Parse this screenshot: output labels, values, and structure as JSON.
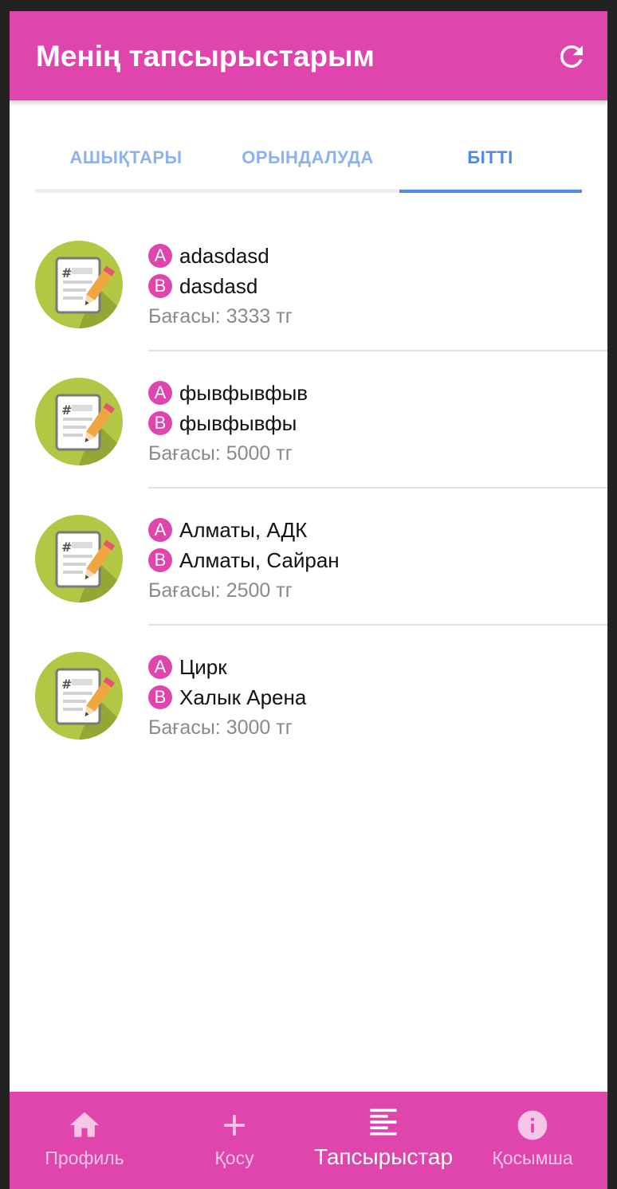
{
  "app_bar": {
    "title": "Менің тапсырыстарым",
    "refresh_icon": "refresh-icon"
  },
  "tabs": [
    {
      "label": "АШЫҚТАРЫ",
      "active": false
    },
    {
      "label": "ОРЫНДАЛУДА",
      "active": false
    },
    {
      "label": "БІТТІ",
      "active": true
    }
  ],
  "orders": [
    {
      "from_badge": "A",
      "from": "adasdasd",
      "to_badge": "B",
      "to": "dasdasd",
      "price": "Бағасы: 3333 тг",
      "icon": "notepad-pencil-icon"
    },
    {
      "from_badge": "A",
      "from": "фывфывфыв",
      "to_badge": "B",
      "to": "фывфывфы",
      "price": "Бағасы: 5000 тг",
      "icon": "notepad-pencil-icon"
    },
    {
      "from_badge": "A",
      "from": "Алматы, АДК",
      "to_badge": "B",
      "to": "Алматы, Сайран",
      "price": "Бағасы: 2500 тг",
      "icon": "notepad-pencil-icon"
    },
    {
      "from_badge": "A",
      "from": "Цирк",
      "to_badge": "B",
      "to": "Халык Арена",
      "price": "Бағасы: 3000 тг",
      "icon": "notepad-pencil-icon"
    }
  ],
  "bottom_nav": [
    {
      "label": "Профиль",
      "icon": "home-icon",
      "active": false
    },
    {
      "label": "Қосу",
      "icon": "plus-icon",
      "active": false
    },
    {
      "label": "Тапсырыстар",
      "icon": "list-icon",
      "active": true
    },
    {
      "label": "Қосымша",
      "icon": "info-icon",
      "active": false
    }
  ],
  "colors": {
    "primary": "#e045ad",
    "tab_active": "#4e8ae6",
    "tab_inactive": "#8db2ee",
    "icon_green": "#b2c743"
  }
}
